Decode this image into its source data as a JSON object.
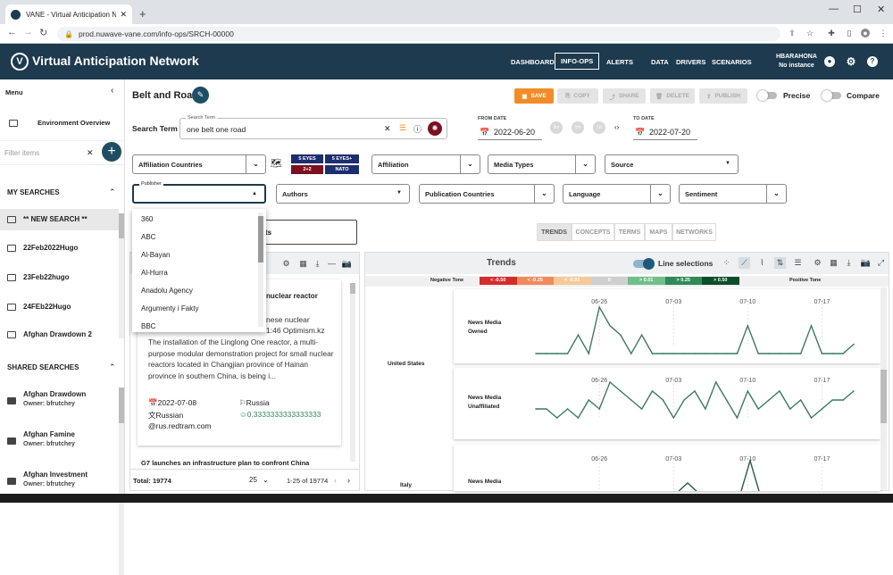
{
  "browser": {
    "tab_title": "VANE - Virtual Anticipation Netw",
    "url": "prod.nuwave-vane.com/info-ops/SRCH-00000"
  },
  "app": {
    "logo_letter": "V",
    "title": "Virtual Anticipation Network",
    "nav": [
      "DASHBOARD",
      "INFO-OPS",
      "ALERTS",
      "DATA",
      "DRIVERS",
      "SCENARIOS"
    ],
    "user_name": "HBARAHONA",
    "user_instance": "No instance"
  },
  "sidebar": {
    "menu_label": "Menu",
    "env_overview": "Environment Overview",
    "filter_placeholder": "Filter items",
    "my_searches_label": "MY SEARCHES",
    "my_searches": [
      "** NEW SEARCH **",
      "22Feb2022Hugo",
      "23Feb22hugo",
      "24FEb22Hugo",
      "Afghan Drawdown 2"
    ],
    "shared_searches_label": "SHARED SEARCHES",
    "shared_searches": [
      {
        "name": "Afghan Drawdown",
        "owner": "Owner: bfrutchey"
      },
      {
        "name": "Afghan Famine",
        "owner": "Owner: bfrutchey"
      },
      {
        "name": "Afghan Investment",
        "owner": "Owner: bfrutchey"
      }
    ]
  },
  "search": {
    "name": "Belt and Road",
    "term_label": "Search Term",
    "term_field_label": "Search Term",
    "term_value": "one belt one road",
    "from_label": "FROM DATE",
    "from_value": "2022-06-20",
    "to_label": "TO DATE",
    "to_value": "2022-07-20",
    "pills": [
      "3m",
      "1m",
      "1d"
    ],
    "buttons": {
      "save": "SAVE",
      "copy": "COPY",
      "share": "SHARE",
      "delete": "DELETE",
      "publish": "PUBLISH"
    },
    "precise_label": "Precise",
    "compare_label": "Compare"
  },
  "filters": {
    "affiliation_countries": "Affiliation Countries",
    "eyes": [
      "5 EYES",
      "5 EYES+",
      "2+2",
      "NATO"
    ],
    "affiliation": "Affiliation",
    "media_types": "Media Types",
    "source": "Source",
    "publisher_label": "Publisher",
    "authors": "Authors",
    "publication_countries": "Publication Countries",
    "language": "Language",
    "sentiment": "Sentiment"
  },
  "publisher_options": [
    "360",
    "ABC",
    "Al-Bayan",
    "Al-Hurra",
    "Anadolu Agency",
    "Argumenty i Fakty",
    "BBC"
  ],
  "results": {
    "hidden_button_tail": "ts",
    "card1_title_tail": "nuclear reactor",
    "card1_line1_tail": "nese nuclear",
    "card1_line2_tail": "1:46 Optimism.kz",
    "card1_body": "The installation of the Linglong One reactor, a multi-purpose modular demonstration project for small nuclear reactors located in Changjian province of Hainan province in southern China, is being i...",
    "card1_date": "2022-07-08",
    "card1_country": "Russia",
    "card1_language": "Russian",
    "card1_sentiment": "0.3333333333333333",
    "card1_source": "@rus.redtram.com",
    "card2_title": "G7 launches an infrastructure plan to confront China",
    "total": "Total: 19774",
    "per_page": "25",
    "range": "1-25 of 19774"
  },
  "view_tabs": [
    "TRENDS",
    "CONCEPTS",
    "TERMS",
    "MAPS",
    "NETWORKS"
  ],
  "trends": {
    "title": "Trends",
    "line_selections": "Line selections",
    "legend_negative": "Negative Tone",
    "legend_positive": "Positive Tone",
    "legend_bins": [
      "< -0.50",
      "< -0.25",
      "< -0.01",
      "0",
      "> 0.01",
      "> 0.25",
      "> 0.50"
    ],
    "legend_colors": [
      "#d62b2b",
      "#f08a5d",
      "#f7c99a",
      "#cfcfcf",
      "#6fbf8b",
      "#2e8b57",
      "#0d4d2c"
    ],
    "country_1": "United States",
    "country_2": "Italy",
    "dates": [
      "06-26",
      "07-03",
      "07-10",
      "07-17"
    ],
    "rows": [
      "News Media Owned",
      "News Media Unaffiliated",
      "News Media"
    ]
  },
  "chart_data": {
    "type": "line",
    "x": [
      "06-20",
      "06-21",
      "06-22",
      "06-23",
      "06-24",
      "06-25",
      "06-26",
      "06-27",
      "06-28",
      "06-29",
      "06-30",
      "07-01",
      "07-02",
      "07-03",
      "07-04",
      "07-05",
      "07-06",
      "07-07",
      "07-08",
      "07-09",
      "07-10",
      "07-11",
      "07-12",
      "07-13",
      "07-14",
      "07-15",
      "07-16",
      "07-17",
      "07-18",
      "07-19",
      "07-20"
    ],
    "series": [
      {
        "name": "News Media Owned",
        "values": [
          0,
          0,
          0,
          0,
          2,
          0,
          5,
          3,
          2,
          0,
          2,
          0,
          0,
          0,
          0,
          0,
          0,
          0,
          0,
          0,
          3,
          0,
          0,
          0,
          0,
          0,
          3,
          0,
          0,
          0,
          1
        ]
      },
      {
        "name": "News Media Unaffiliated",
        "values": [
          1,
          1,
          0,
          1,
          0,
          2,
          1,
          4,
          3,
          2,
          1,
          3,
          2,
          0,
          2,
          3,
          1,
          4,
          2,
          0,
          3,
          1,
          2,
          3,
          1,
          2,
          0,
          1,
          2,
          2,
          3
        ]
      }
    ]
  }
}
